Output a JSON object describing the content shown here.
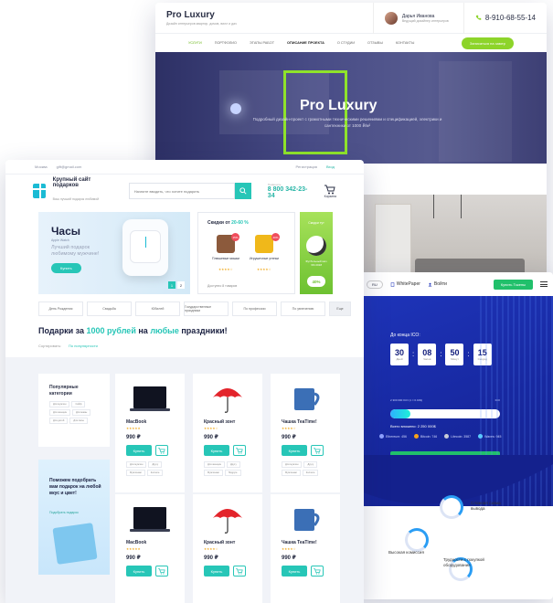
{
  "luxury": {
    "brand": "Pro Luxury",
    "tagline": "Дизайн интерьеров квартир, домов, вилл и дач",
    "user_name": "Дарья Иванова",
    "user_role": "Ведущий дизайнер интерьеров",
    "phone": "8-910-68-55-14",
    "nav": [
      "Услуги",
      "Портфолио",
      "Этапы работ",
      "Описание проекта",
      "О студии",
      "Отзывы",
      "Контакты"
    ],
    "cta": "Записаться на замер",
    "hero_title": "Pro Luxury",
    "hero_sub": "Подробный дизайн-проект с грамотными техническими решениями и спецификацией, электрики и сантехники от 1000 ₽/м²"
  },
  "ico": {
    "lang": "RU",
    "whitepaper": "WhitePaper",
    "login": "Войти",
    "cta": "Купить Токены",
    "label": "До конца ICO:",
    "timer": [
      {
        "value": "30",
        "unit": "Дней"
      },
      {
        "value": "08",
        "unit": "Часов"
      },
      {
        "value": "50",
        "unit": "Минут"
      },
      {
        "value": "15",
        "unit": "Секунд"
      }
    ],
    "raised_left": "2 300 000 ICO (1 = 0.01$)",
    "raised_right": "ICO",
    "progress": 0.18,
    "collected": "Всего вложено: 2 250 000$",
    "rates": [
      "Ethereum: 456",
      "Bitcoin: 746",
      "Litecoin: 3587",
      "Waves: 945"
    ],
    "buy": "Купить MinerToken",
    "features": [
      "Сложная схема вывода",
      "Высокая комиссия",
      "Трудности с покупкой оборудования"
    ]
  },
  "gift": {
    "topbar_left": [
      "Москва",
      "gift@gmail.com"
    ],
    "topbar_right": [
      "Регистрация",
      "Вход"
    ],
    "logo_title": "Крупный сайт подарков",
    "logo_sub": "Ваш лучший подарок любимой",
    "search_placeholder": "Начните вводить, что хотите подарить",
    "phone_label": "Позвонить",
    "phone": "8 800 342-23-34",
    "cart_label": "Корзина",
    "banner": {
      "title": "Часы",
      "brand": "Apple Watch",
      "text": "Лучший подарок любимому мужчине!",
      "button": "Купить",
      "pages": [
        "1",
        "2"
      ]
    },
    "sale": {
      "prefix": "Скидки от ",
      "range": "20-60 %",
      "items": [
        {
          "name": "Плюшевые мишки",
          "badge": "15%",
          "stars": "★★★★☆"
        },
        {
          "name": "Игрушечные утенки",
          "badge": "40%",
          "stars": "★★★★☆"
        }
      ],
      "footer": "Доступно 8 товаров"
    },
    "promo": {
      "title": "Скидки тут",
      "text": "Футбольный мяч ЧМ 2018",
      "pct": "40%"
    },
    "categories": [
      "День Рождения",
      "Свадьба",
      "Юбилей",
      "Государственные праздники",
      "По профессии",
      "По увлечению",
      "Еще"
    ],
    "heading_1": "Подарки за ",
    "heading_price": "1000 рублей",
    "heading_2": " на ",
    "heading_any": "любые",
    "heading_3": " праздники!",
    "sort_label": "Сортировать:",
    "sort_value": "По популярности",
    "sidebar_title": "Популярные категории",
    "sidebar_tags": [
      "Для мужчин",
      "Сейф",
      "Для женщин",
      "Для мамы",
      "Для детей",
      "Для папы"
    ],
    "help_title": "Поможем подобрать вам подарок на любой вкус и цвет!",
    "help_button": "Подобрать подарок",
    "products": [
      {
        "name": "MacBook",
        "price": "990 ₽",
        "stars": "★★★★★",
        "kind": "laptop",
        "tags": [
          "Для мужчин",
          "Другу",
          "Мужчинам",
          "Коллеге"
        ]
      },
      {
        "name": "Красный зонт",
        "price": "990 ₽",
        "stars": "★★★★☆",
        "kind": "umbrella",
        "tags": [
          "Для женщин",
          "Другу",
          "Мужчинам",
          "Подруге"
        ]
      },
      {
        "name": "Чашка TeaTime!",
        "price": "990 ₽",
        "stars": "★★★★☆",
        "kind": "cup",
        "tags": [
          "Для мужчин",
          "Другу",
          "Мужчинам",
          "Коллеге"
        ]
      },
      {
        "name": "MacBook",
        "price": "990 ₽",
        "stars": "★★★★★",
        "kind": "laptop",
        "tags": []
      },
      {
        "name": "Красный зонт",
        "price": "990 ₽",
        "stars": "★★★★☆",
        "kind": "umbrella",
        "tags": []
      },
      {
        "name": "Чашка TeaTime!",
        "price": "990 ₽",
        "stars": "★★★★☆",
        "kind": "cup",
        "tags": []
      }
    ],
    "buy_label": "Купить"
  }
}
